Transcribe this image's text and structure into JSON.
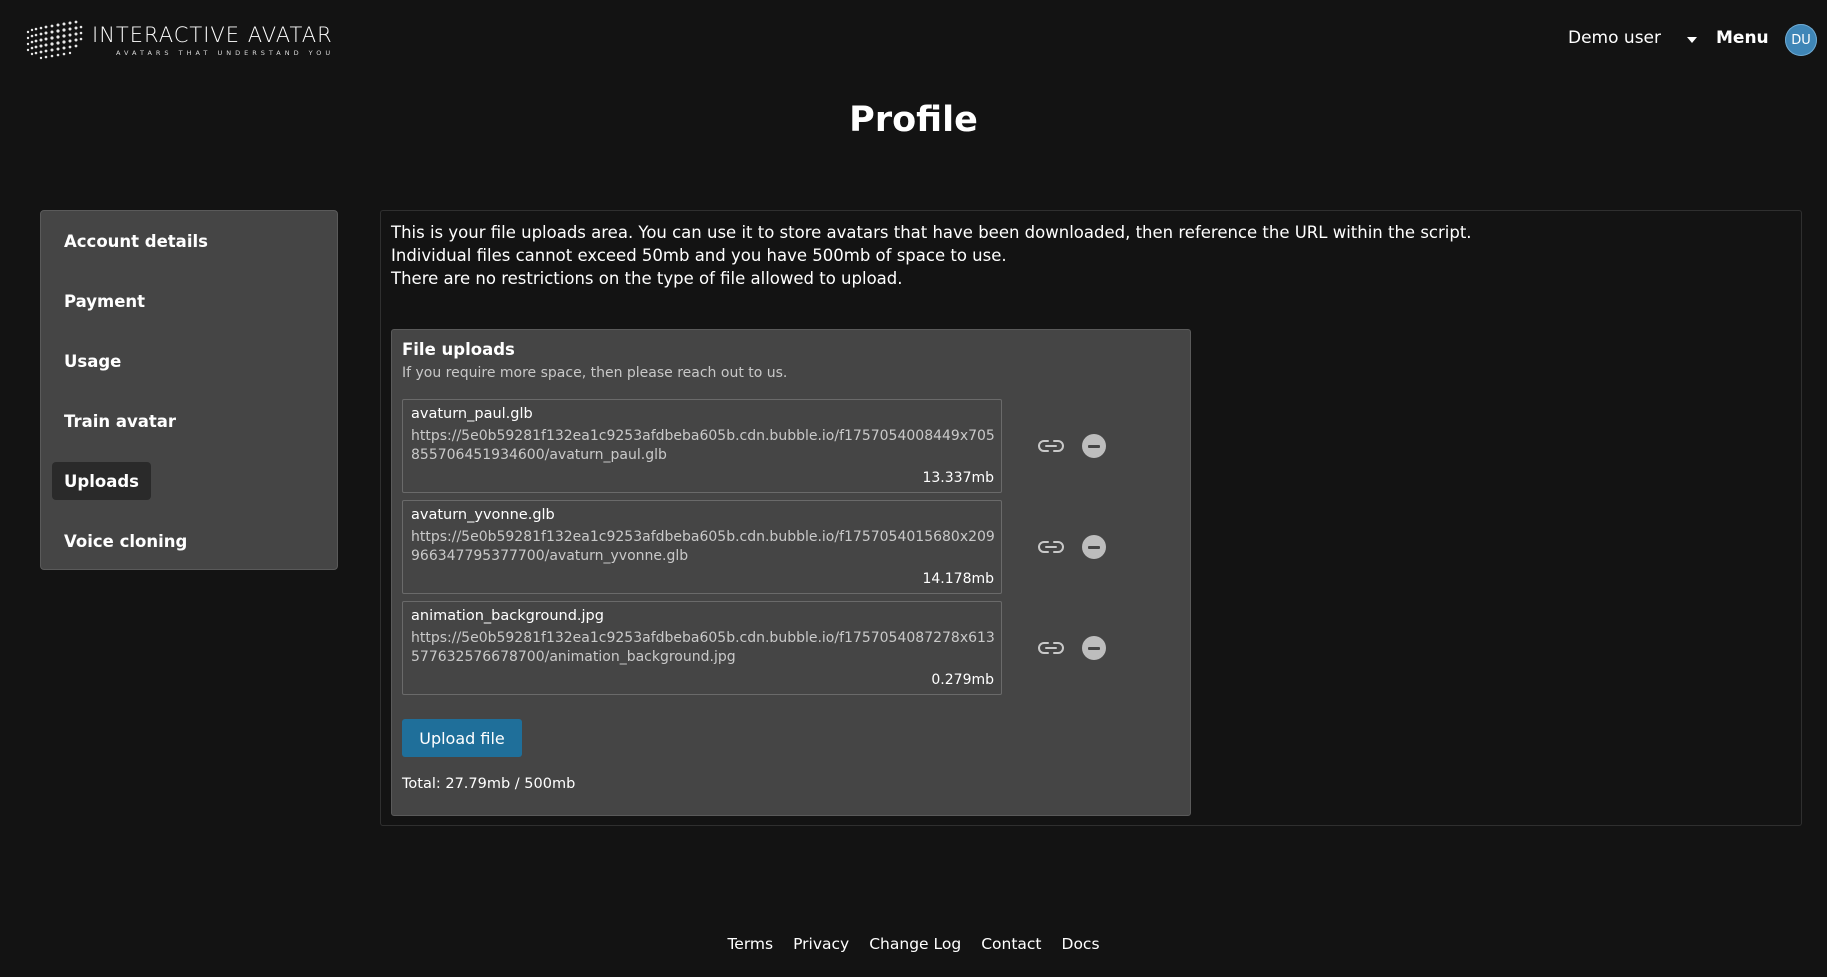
{
  "brand": {
    "name": "INTERACTIVE AVATAR",
    "tagline": "AVATARS THAT UNDERSTAND YOU"
  },
  "header": {
    "user_name": "Demo user",
    "menu_label": "Menu",
    "avatar_initials": "DU"
  },
  "page": {
    "title": "Profile"
  },
  "sidebar": {
    "items": [
      {
        "label": "Account details",
        "active": false
      },
      {
        "label": "Payment",
        "active": false
      },
      {
        "label": "Usage",
        "active": false
      },
      {
        "label": "Train avatar",
        "active": false
      },
      {
        "label": "Uploads",
        "active": true
      },
      {
        "label": "Voice cloning",
        "active": false
      }
    ]
  },
  "intro": {
    "line1": "This is your file uploads area. You can use it to store avatars that have been downloaded, then reference the URL within the script.",
    "line2": "Individual files cannot exceed 50mb and you have 500mb of space to use.",
    "line3": "There are no restrictions on the type of file allowed to upload."
  },
  "uploads": {
    "title": "File uploads",
    "subtitle": "If you require more space, then please reach out to us.",
    "files": [
      {
        "name": "avaturn_paul.glb",
        "url": "https://5e0b59281f132ea1c9253afdbeba605b.cdn.bubble.io/f1757054008449x705855706451934600/avaturn_paul.glb",
        "size": "13.337mb"
      },
      {
        "name": "avaturn_yvonne.glb",
        "url": "https://5e0b59281f132ea1c9253afdbeba605b.cdn.bubble.io/f1757054015680x209966347795377700/avaturn_yvonne.glb",
        "size": "14.178mb"
      },
      {
        "name": "animation_background.jpg",
        "url": "https://5e0b59281f132ea1c9253afdbeba605b.cdn.bubble.io/f1757054087278x613577632576678700/animation_background.jpg",
        "size": "0.279mb"
      }
    ],
    "upload_button": "Upload file",
    "total": "Total: 27.79mb / 500mb"
  },
  "footer": {
    "links": [
      "Terms",
      "Privacy",
      "Change Log",
      "Contact",
      "Docs"
    ]
  },
  "colors": {
    "background": "#131313",
    "panel": "#454545",
    "accent_button": "#1f6f9a",
    "avatar": "#3f86b7"
  }
}
